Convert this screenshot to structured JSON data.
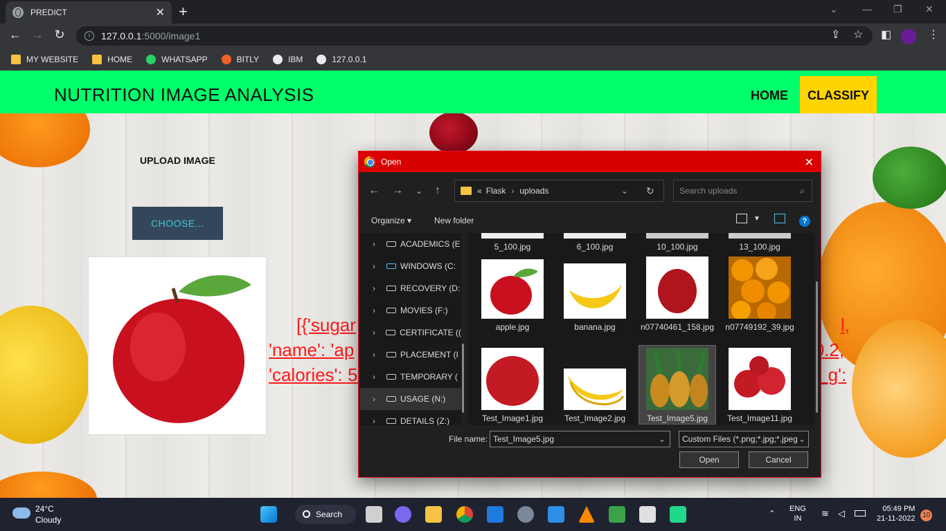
{
  "browser": {
    "tab_title": "PREDICT",
    "url_host": "127.0.0.1",
    "url_path": ":5000/image1",
    "bookmarks": [
      "MY WEBSITE",
      "HOME",
      "WHATSAPP",
      "BITLY",
      "IBM",
      "127.0.0.1"
    ]
  },
  "page": {
    "brand": "NUTRITION IMAGE ANALYSIS",
    "nav_home": "HOME",
    "nav_classify": "CLASSIFY",
    "upload_title": "UPLOAD IMAGE",
    "choose_label": "CHOOSE...",
    "result_line1": "[{'sugar",
    "result_line1_tail": "l,",
    "result_line2": "'name': 'ap",
    "result_line2_tail": ": 0.2,",
    "result_line3": "'calories': 53",
    "result_line3_tail": "al_g':"
  },
  "dialog": {
    "title": "Open",
    "path_prefix": "«",
    "path_parent": "Flask",
    "path_current": "uploads",
    "search_placeholder": "Search uploads",
    "organize": "Organize",
    "new_folder": "New folder",
    "help": "?",
    "tree": [
      {
        "label": "ACADEMICS (E"
      },
      {
        "label": "WINDOWS (C:"
      },
      {
        "label": "RECOVERY (D:"
      },
      {
        "label": "MOVIES (F:)"
      },
      {
        "label": "CERTIFICATE (("
      },
      {
        "label": "PLACEMENT (I"
      },
      {
        "label": "TEMPORARY ("
      },
      {
        "label": "USAGE (N:)"
      },
      {
        "label": "DETAILS (Z:)"
      }
    ],
    "files_row0": [
      "5_100.jpg",
      "6_100.jpg",
      "10_100.jpg",
      "13_100.jpg"
    ],
    "files_row1": [
      "apple.jpg",
      "banana.jpg",
      "n07740461_158.jpg",
      "n07749192_39.jpg"
    ],
    "files_row2": [
      "Test_Image1.jpg",
      "Test_Image2.jpg",
      "Test_Image5.jpg",
      "Test_Image11.jpg"
    ],
    "file_name_label": "File name:",
    "file_name_value": "Test_Image5.jpg",
    "file_type": "Custom Files (*.png;*.jpg;*.jpeg",
    "open_button": "Open",
    "cancel_button": "Cancel"
  },
  "taskbar": {
    "temp": "24°C",
    "weather": "Cloudy",
    "search": "Search",
    "lang_line1": "ENG",
    "lang_line2": "IN",
    "time": "05:49 PM",
    "date": "21-11-2022",
    "notifications": "10"
  }
}
